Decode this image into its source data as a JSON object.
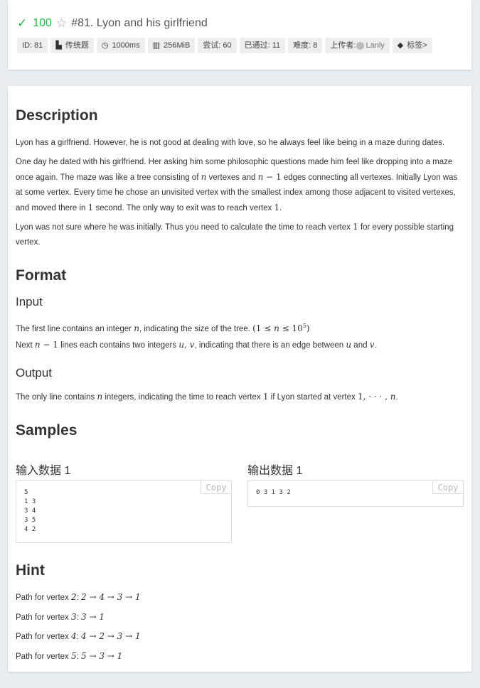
{
  "problem": {
    "score": "100",
    "title": "#81. Lyon and his girlfriend"
  },
  "badges": {
    "id": "ID: 81",
    "type": "传统题",
    "time": "1000ms",
    "memory": "256MiB",
    "tries": "尝试: 60",
    "passed": "已通过: 11",
    "difficulty": "难度: 8",
    "uploader_label": "上传者:",
    "uploader_name": "Lanly",
    "tags": "标签>"
  },
  "description": {
    "heading": "Description",
    "p1": "Lyon has a girlfriend. However, he is not good at dealing with love, so he always feel like being in a maze during dates.",
    "p2_a": "One day he dated with his girlfriend. Her asking him some philosophic questions made him feel like dropping into a maze once again. The maze was like a tree consisting of ",
    "p2_b": " vertexes and ",
    "p2_c": " edges connecting all vertexes. Initially Lyon was at some vertex. Every time he chose an unvisited vertex with the smallest index among those adjacent to visited vertexes, and moved there in ",
    "p2_d": " second. The only way to exit was to reach vertex ",
    "p3_a": "Lyon was not sure where he was initially. Thus you need to calculate the time to reach vertex ",
    "p3_b": " for every possible starting vertex."
  },
  "format": {
    "heading": "Format",
    "input_heading": "Input",
    "input_p1_a": "The first line contains an integer ",
    "input_p1_b": ", indicating the size of the tree. ",
    "input_p2_a": "Next ",
    "input_p2_b": " lines each contains two integers ",
    "input_p2_c": ", indicating that there is an edge between ",
    "input_p2_d": " and ",
    "output_heading": "Output",
    "output_p_a": "The only line contains ",
    "output_p_b": " integers, indicating the time to reach vertex ",
    "output_p_c": " if Lyon started at vertex "
  },
  "samples": {
    "heading": "Samples",
    "input_title": "输入数据 1",
    "output_title": "输出数据 1",
    "input_data": "5\n1 3\n3 4\n3 5\n4 2",
    "output_data": "0 3 1 3 2",
    "copy_label": "Copy"
  },
  "hint": {
    "heading": "Hint",
    "prefix": "Path for vertex ",
    "paths": [
      {
        "vertex": "2",
        "path": "2 → 4 → 3 → 1"
      },
      {
        "vertex": "3",
        "path": "3 → 1"
      },
      {
        "vertex": "4",
        "path": "4 → 2 → 3 → 1"
      },
      {
        "vertex": "5",
        "path": "5 → 3 → 1"
      }
    ]
  },
  "colors": {
    "accepted": "#21ba45",
    "background": "#e9eef1",
    "badge_bg": "#eceeef"
  },
  "icons": [
    "check-icon",
    "star-icon",
    "book-icon",
    "timer-icon",
    "memory-icon",
    "tag-icon"
  ]
}
